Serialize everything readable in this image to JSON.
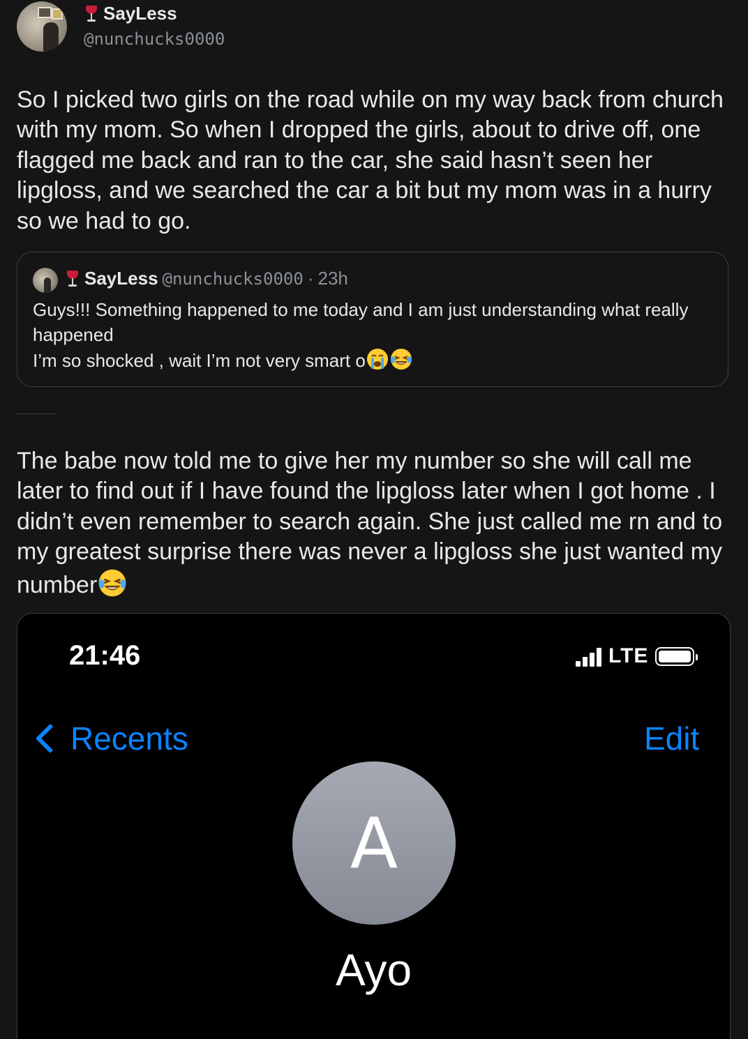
{
  "author": {
    "name": "SayLess",
    "handle": "@nunchucks0000",
    "name_emoji": "wine-glass-icon"
  },
  "tweet": {
    "text_part1": "So I picked two girls on the road while on my way back from church with my mom. So when I dropped the girls, about to drive off, one flagged me back and ran to the car, she said hasn’t seen her lipgloss, and we searched the car a bit but my mom was in a hurry so we had to go.",
    "text_part2": "The babe now told me to give her my number so she will call me later to find out if I have found the lipgloss later when I got home . I didn’t even remember to search again. She just called me rn and to my greatest surprise there was never a lipgloss she just wanted my number"
  },
  "quoted_tweet": {
    "name": "SayLess",
    "handle": "@nunchucks0000",
    "separator": "·",
    "time": "23h",
    "text_line1": "Guys!!! Something happened to me today and I am just understanding what really happened",
    "text_line2": "I’m so shocked , wait I’m not very smart o"
  },
  "phone_screenshot": {
    "time": "21:46",
    "network": "LTE",
    "back_label": "Recents",
    "edit_label": "Edit",
    "contact_initial": "A",
    "contact_name": "Ayo",
    "accent_color": "#0a84ff",
    "avatar_color": "#8e929c"
  },
  "colors": {
    "background": "#151515",
    "text": "#e7e9ea",
    "secondary_text": "#8b9199",
    "border": "#3c3f44"
  }
}
